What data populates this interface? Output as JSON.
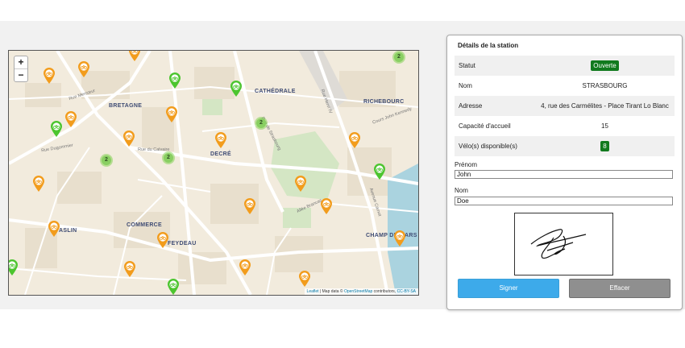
{
  "map": {
    "zoom_in": "+",
    "zoom_out": "−",
    "districts": [
      "BRETAGNE",
      "CATHÉDRALE",
      "RICHEBOURC",
      "DECRÉ",
      "COMMERCE",
      "FEYDEAU",
      "CHAMP DE MARS",
      "ASLIN"
    ],
    "streets": [
      "Rue Mercœur",
      "Rue Henri IV",
      "Cours John Kennedy",
      "Avenue Carnot",
      "Allée Brancas",
      "Rue de Strasbourg",
      "Rue du Calvaire",
      "Rue Dugommier"
    ],
    "clusters": [
      "2",
      "2",
      "2",
      "2"
    ],
    "attribution": {
      "leaflet": "Leaflet",
      "text": " | Map data © ",
      "osm": "OpenStreetMap",
      "contrib": " contributors, ",
      "license": "CC-BY-SA"
    },
    "colors": {
      "orange_marker": "#f29c1c",
      "green_marker": "#4cc52f",
      "cluster": "#89cf62"
    }
  },
  "panel": {
    "title": "Détails de la station",
    "rows": [
      {
        "label": "Statut",
        "value": "Ouverte"
      },
      {
        "label": "Nom",
        "value": "STRASBOURG"
      },
      {
        "label": "Adresse",
        "value": "4, rue des Carmélites - Place Tirant Lo Blanc"
      },
      {
        "label": "Capacité d'accueil",
        "value": "15"
      },
      {
        "label": "Vélo(s) disponible(s)",
        "value": "8"
      }
    ],
    "prenom_label": "Prénom",
    "prenom_value": "John",
    "nom_label": "Nom",
    "nom_value": "Doe",
    "sign_button": "Signer",
    "clear_button": "Effacer",
    "colors": {
      "badge": "#117a1e",
      "sign": "#3daaea",
      "clear": "#8f8f8f"
    }
  }
}
